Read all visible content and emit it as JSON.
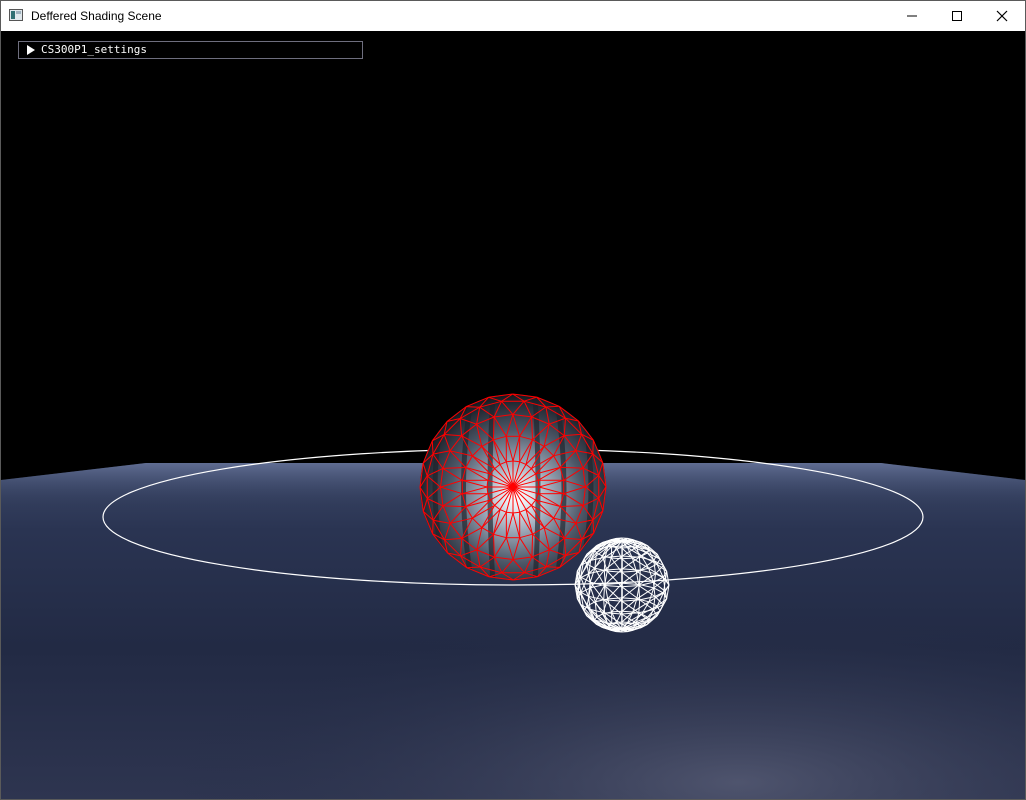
{
  "window": {
    "title": "Deffered Shading Scene",
    "icon": "app-window-icon",
    "controls": {
      "minimize_icon": "minimize-icon",
      "maximize_icon": "maximize-icon",
      "close_icon": "close-icon"
    }
  },
  "settings_panel": {
    "label": "CS300P1_settings",
    "state": "collapsed",
    "icon": "collapse-arrow-icon"
  },
  "scene": {
    "background_color": "#000000",
    "floor_color": "#26304a",
    "floor_highlight_color": "#4a5068",
    "orbit_ring_color": "#ffffff",
    "main_sphere_wireframe_color": "#ff0000",
    "light_sphere_wireframe_color": "#ffffff"
  }
}
